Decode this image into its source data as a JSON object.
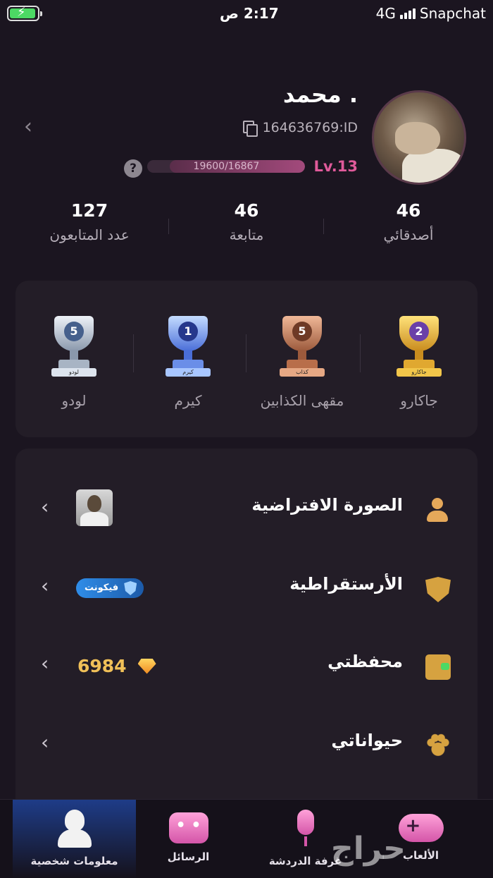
{
  "status_bar": {
    "time": "2:17 ص",
    "network": "4G",
    "carrier": "Snapchat"
  },
  "profile": {
    "name": "محمد .",
    "id": "164636769:ID",
    "level": "Lv.13",
    "xp_text": "19600/16867",
    "xp_progress_fraction": 0.86,
    "help": "?"
  },
  "stats": [
    {
      "value": "46",
      "label": "أصدقائي"
    },
    {
      "value": "46",
      "label": "متابعة"
    },
    {
      "value": "127",
      "label": "عدد المتابعون"
    }
  ],
  "trophies": [
    {
      "label": "جاكارو",
      "rank": "2",
      "tier": "gold",
      "ribbon": "جاكارو"
    },
    {
      "label": "مقهى الكذابين",
      "rank": "5",
      "tier": "bronze",
      "ribbon": "كذاب"
    },
    {
      "label": "كيرم",
      "rank": "1",
      "tier": "blue",
      "ribbon": "كيرم"
    },
    {
      "label": "لودو",
      "rank": "5",
      "tier": "silver",
      "ribbon": "لودو"
    }
  ],
  "settings": {
    "avatar_label": "الصورة الافتراضية",
    "aristocracy_label": "الأرستقراطية",
    "aristocracy_badge": "فيكونت",
    "wallet_label": "محفظتي",
    "wallet_value": "6984",
    "pets_label": "حيواناتي"
  },
  "bottom_nav": [
    {
      "label": "معلومات شخصية",
      "active": true
    },
    {
      "label": "الرسائل",
      "active": false
    },
    {
      "label": "غرفة الدردشة",
      "active": false
    },
    {
      "label": "الألعاب",
      "active": false
    }
  ],
  "watermark": "حراج",
  "colors": {
    "background": "#1b1520",
    "card": "#231d27",
    "level_pink": "#e05a9a",
    "gold_icon": "#d6a240",
    "wallet_gold": "#f0c058",
    "active_tab": "#1e3c88"
  }
}
